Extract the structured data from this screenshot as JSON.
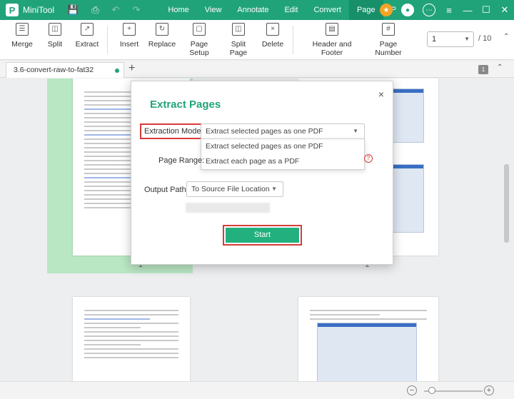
{
  "app": {
    "name": "MiniTool",
    "logo_letter": "P"
  },
  "titlebar": {
    "menu": [
      "Home",
      "View",
      "Annotate",
      "Edit",
      "Convert",
      "Page",
      "P"
    ],
    "active_menu": "Page",
    "quick_icons": [
      "save-icon",
      "print-icon",
      "undo-icon",
      "redo-icon"
    ],
    "right_icons": [
      "store-icon",
      "user-icon",
      "chat-icon"
    ],
    "window_controls": [
      "≡",
      "—",
      "☐",
      "✕"
    ]
  },
  "toolbar": {
    "tools": [
      {
        "label": "Merge",
        "icon": "merge-icon"
      },
      {
        "label": "Split",
        "icon": "split-icon"
      },
      {
        "label": "Extract",
        "icon": "extract-icon"
      },
      {
        "label": "Insert",
        "icon": "insert-icon"
      },
      {
        "label": "Replace",
        "icon": "replace-icon"
      },
      {
        "label": "Page Setup",
        "icon": "page-setup-icon"
      },
      {
        "label": "Split Page",
        "icon": "split-page-icon"
      },
      {
        "label": "Delete",
        "icon": "delete-icon"
      },
      {
        "label": "Header and Footer",
        "icon": "header-footer-icon"
      },
      {
        "label": "Page Number",
        "icon": "page-number-icon"
      }
    ],
    "page_current": "1",
    "page_total": "/ 10"
  },
  "tabs": {
    "doc_tab": "3.6-convert-raw-to-fat32",
    "add": "+",
    "page_badge": "1"
  },
  "pages": {
    "numbers": [
      "1",
      "2"
    ]
  },
  "dialog": {
    "title": "Extract Pages",
    "close": "×",
    "extraction_mode_label": "Extraction Mode:",
    "extraction_mode_value": "Extract selected pages as one PDF",
    "options": [
      "Extract selected pages as one PDF",
      "Extract each page as a PDF"
    ],
    "page_range_label": "Page Range:",
    "output_path_label": "Output Path:",
    "output_path_value": "To Source File Location",
    "start_label": "Start",
    "highlight_color": "#d93a3a",
    "accent_color": "#21a37a"
  },
  "statusbar": {
    "zoom_out": "−",
    "zoom_in": "+"
  }
}
